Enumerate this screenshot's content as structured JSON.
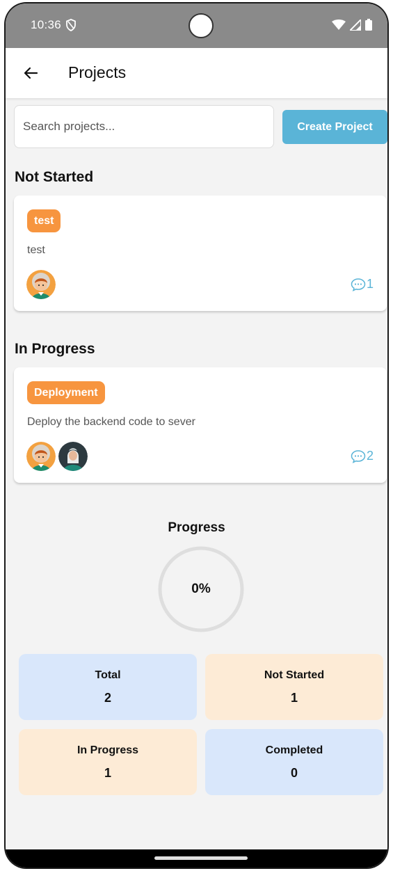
{
  "status_bar": {
    "time": "10:36"
  },
  "app_bar": {
    "title": "Projects"
  },
  "search": {
    "placeholder": "Search projects...",
    "value": ""
  },
  "create_button": {
    "label": "Create Project"
  },
  "sections": [
    {
      "title": "Not Started",
      "projects": [
        {
          "tag": "test",
          "description": "test",
          "comments": "1",
          "avatars": [
            "boy-avatar-icon"
          ]
        }
      ]
    },
    {
      "title": "In Progress",
      "projects": [
        {
          "tag": "Deployment",
          "description": "Deploy the backend code to sever",
          "comments": "2",
          "avatars": [
            "boy-avatar-icon",
            "woman-avatar-icon"
          ]
        }
      ]
    }
  ],
  "progress": {
    "title": "Progress",
    "value": "0%",
    "fraction": 0
  },
  "stats": [
    {
      "label": "Total",
      "value": "2",
      "color": "#d9e7fb"
    },
    {
      "label": "Not Started",
      "value": "1",
      "color": "#fdebd6"
    },
    {
      "label": "In Progress",
      "value": "1",
      "color": "#fdebd6"
    },
    {
      "label": "Completed",
      "value": "0",
      "color": "#d9e7fb"
    }
  ],
  "colors": {
    "accent": "#5ab4d7",
    "tag": "#f7953f",
    "background": "#f3f3f3"
  }
}
